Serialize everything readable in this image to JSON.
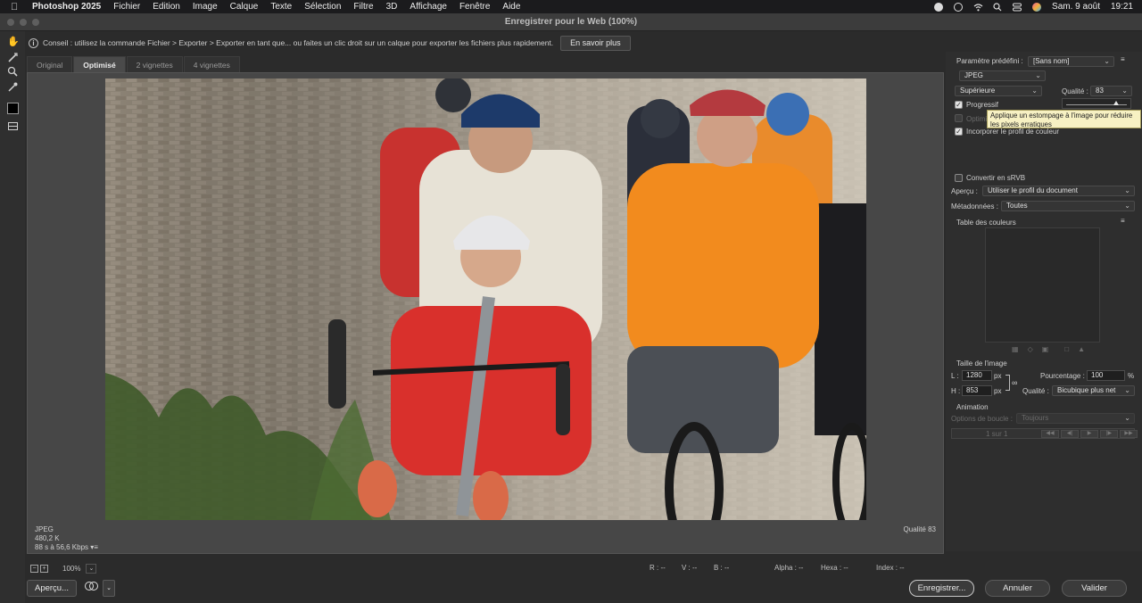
{
  "menubar": {
    "app": "Photoshop 2025",
    "items": [
      "Fichier",
      "Edition",
      "Image",
      "Calque",
      "Texte",
      "Sélection",
      "Filtre",
      "3D",
      "Affichage",
      "Fenêtre",
      "Aide"
    ],
    "date": "Sam. 9 août",
    "time": "19:21"
  },
  "window": {
    "title": "Enregistrer pour le Web (100%)"
  },
  "tip": {
    "text": "Conseil : utilisez la commande Fichier > Exporter > Exporter en tant que... ou faites un clic droit sur un calque pour exporter les fichiers plus rapidement.",
    "button": "En savoir plus"
  },
  "tabs": [
    {
      "label": "Original",
      "active": false
    },
    {
      "label": "Optimisé",
      "active": true
    },
    {
      "label": "2 vignettes",
      "active": false
    },
    {
      "label": "4 vignettes",
      "active": false
    }
  ],
  "preview": {
    "format": "JPEG",
    "size": "480,2 K",
    "download": "88 s à 56,6 Kbps",
    "quality": "Qualité 83"
  },
  "status": {
    "zoom": "100%",
    "r": "R : --",
    "v": "V : --",
    "b": "B : --",
    "alpha": "Alpha : --",
    "hexa": "Hexa : --",
    "index": "Index : --"
  },
  "buttons": {
    "apercu": "Aperçu...",
    "enregistrer": "Enregistrer...",
    "annuler": "Annuler",
    "valider": "Valider"
  },
  "panel": {
    "preset_label": "Paramètre prédéfini :",
    "preset_value": "[Sans nom]",
    "format": "JPEG",
    "compression": "Supérieure",
    "quality_label": "Qualité :",
    "quality_value": "83",
    "quality_slider": 0.83,
    "progressif": "Progressif",
    "optimise": "Optimisé",
    "profil": "Incorporer le profil de couleur",
    "tooltip": "Applique un estompage à l'image pour réduire les pixels erratiques",
    "srvb": "Convertir en sRVB",
    "apercu_label": "Aperçu :",
    "apercu_value": "Utiliser le profil du document",
    "meta_label": "Métadonnées :",
    "meta_value": "Toutes",
    "color_table": "Table des couleurs",
    "image_size": "Taille de l'image",
    "w_label": "L :",
    "w_value": "1280",
    "h_label": "H :",
    "h_value": "853",
    "px": "px",
    "percent_label": "Pourcentage :",
    "percent_value": "100",
    "percent_unit": "%",
    "resample_label": "Qualité :",
    "resample_value": "Bicubique plus net",
    "animation": "Animation",
    "loop_label": "Options de boucle :",
    "loop_value": "Toujours",
    "frame": "1 sur 1"
  }
}
